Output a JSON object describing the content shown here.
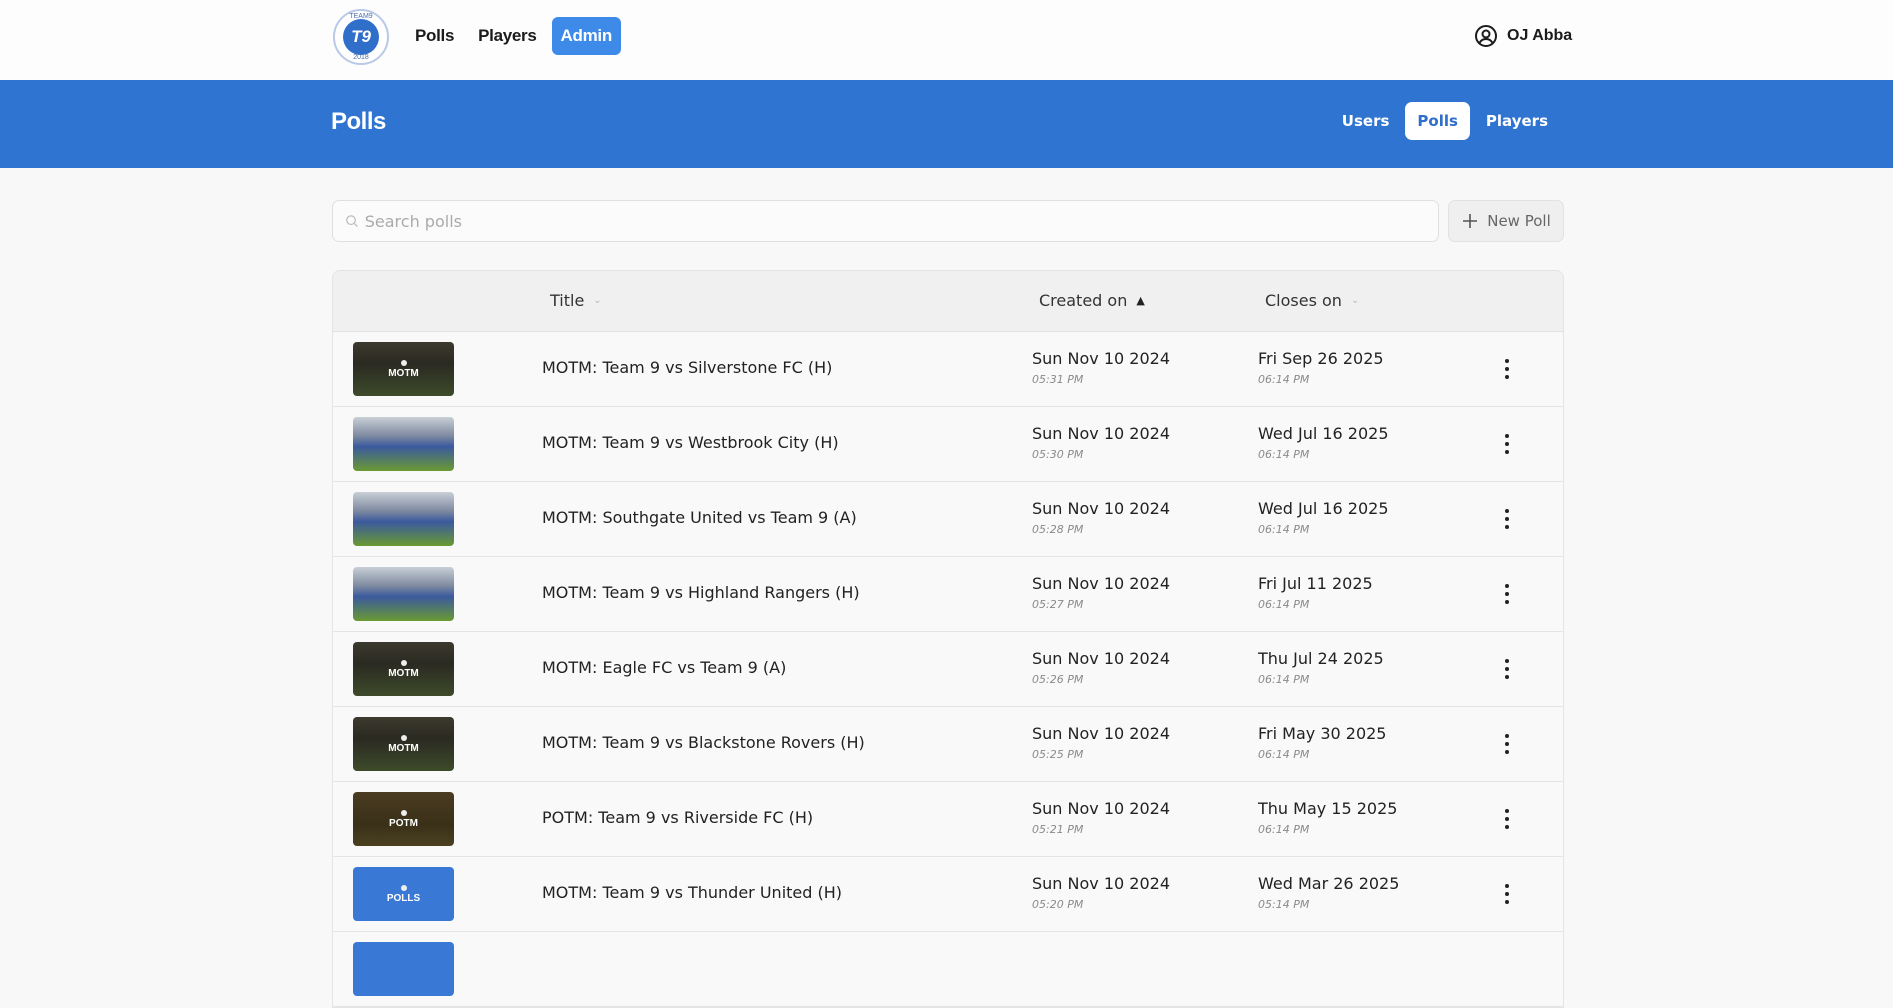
{
  "topbar": {
    "logo": {
      "top_text": "TEAM9",
      "center_text": "T9",
      "bottom_text": "2018"
    },
    "nav": [
      {
        "label": "Polls",
        "active": false
      },
      {
        "label": "Players",
        "active": false
      },
      {
        "label": "Admin",
        "active": true
      }
    ],
    "user": {
      "icon": "user-circle-icon",
      "name": "OJ Abba"
    }
  },
  "band": {
    "title": "Polls",
    "tabs": [
      {
        "label": "Users",
        "active": false
      },
      {
        "label": "Polls",
        "active": true
      },
      {
        "label": "Players",
        "active": false
      }
    ]
  },
  "toolbar": {
    "search_placeholder": "Search polls",
    "search_value": "",
    "new_poll_label": "New Poll"
  },
  "table": {
    "columns": [
      {
        "label": "Title",
        "sort": "none"
      },
      {
        "label": "Created on",
        "sort": "asc"
      },
      {
        "label": "Closes on",
        "sort": "none"
      }
    ],
    "rows": [
      {
        "thumb_label": "MOTM",
        "thumb_style": "dark",
        "title": "MOTM: Team 9 vs Silverstone FC (H)",
        "created_date": "Sun Nov 10 2024",
        "created_time": "05:31 PM",
        "closes_date": "Fri Sep 26 2025",
        "closes_time": "06:14 PM"
      },
      {
        "thumb_label": "",
        "thumb_style": "photo",
        "title": "MOTM: Team 9 vs Westbrook City (H)",
        "created_date": "Sun Nov 10 2024",
        "created_time": "05:30 PM",
        "closes_date": "Wed Jul 16 2025",
        "closes_time": "06:14 PM"
      },
      {
        "thumb_label": "",
        "thumb_style": "photo",
        "title": "MOTM: Southgate United vs Team 9 (A)",
        "created_date": "Sun Nov 10 2024",
        "created_time": "05:28 PM",
        "closes_date": "Wed Jul 16 2025",
        "closes_time": "06:14 PM"
      },
      {
        "thumb_label": "",
        "thumb_style": "photo",
        "title": "MOTM: Team 9 vs Highland Rangers (H)",
        "created_date": "Sun Nov 10 2024",
        "created_time": "05:27 PM",
        "closes_date": "Fri Jul 11 2025",
        "closes_time": "06:14 PM"
      },
      {
        "thumb_label": "MOTM",
        "thumb_style": "dark",
        "title": "MOTM: Eagle FC vs Team 9 (A)",
        "created_date": "Sun Nov 10 2024",
        "created_time": "05:26 PM",
        "closes_date": "Thu Jul 24 2025",
        "closes_time": "06:14 PM"
      },
      {
        "thumb_label": "MOTM",
        "thumb_style": "dark",
        "title": "MOTM: Team 9 vs Blackstone Rovers (H)",
        "created_date": "Sun Nov 10 2024",
        "created_time": "05:25 PM",
        "closes_date": "Fri May 30 2025",
        "closes_time": "06:14 PM"
      },
      {
        "thumb_label": "POTM",
        "thumb_style": "dark2",
        "title": "POTM: Team 9 vs Riverside FC (H)",
        "created_date": "Sun Nov 10 2024",
        "created_time": "05:21 PM",
        "closes_date": "Thu May 15 2025",
        "closes_time": "06:14 PM"
      },
      {
        "thumb_label": "POLLS",
        "thumb_style": "blue",
        "title": "MOTM: Team 9 vs Thunder United (H)",
        "created_date": "Sun Nov 10 2024",
        "created_time": "05:20 PM",
        "closes_date": "Wed Mar 26 2025",
        "closes_time": "05:14 PM"
      },
      {
        "thumb_label": "",
        "thumb_style": "blue",
        "title": "",
        "created_date": "",
        "created_time": "",
        "closes_date": "",
        "closes_time": ""
      }
    ]
  },
  "colors": {
    "brand_blue": "#2f74d0",
    "admin_active": "#3d8ae8"
  }
}
